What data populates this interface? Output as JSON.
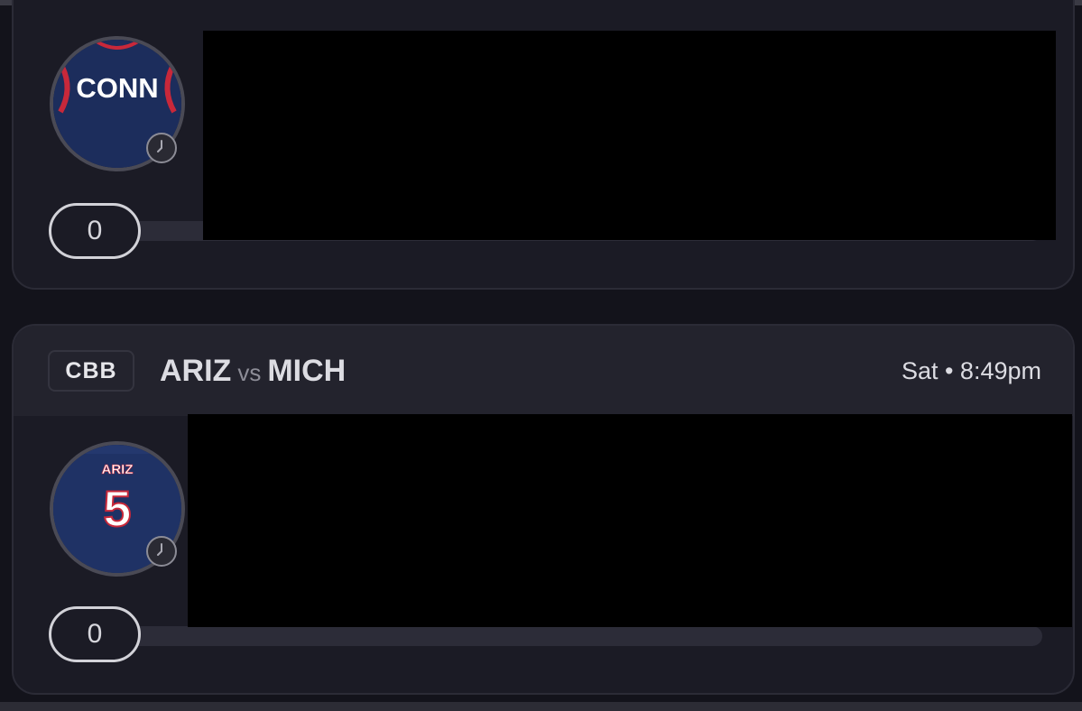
{
  "colors": {
    "background": "#13131b",
    "card": "#1b1b25",
    "card_header": "#23232d",
    "jersey_navy": "#1a2a55",
    "jersey_trim": "#c8283a",
    "redaction": "#000000"
  },
  "cards": [
    {
      "avatar": {
        "jersey_text": "CONN",
        "status_icon": "clock-icon"
      },
      "count": "0"
    },
    {
      "league": "CBB",
      "matchup": {
        "team_a": "ARIZ",
        "vs": "vs",
        "team_b": "MICH"
      },
      "game_time": "Sat • 8:49pm",
      "avatar": {
        "jersey_text": "ARIZ",
        "jersey_number": "5",
        "status_icon": "clock-icon"
      },
      "count": "0"
    }
  ]
}
